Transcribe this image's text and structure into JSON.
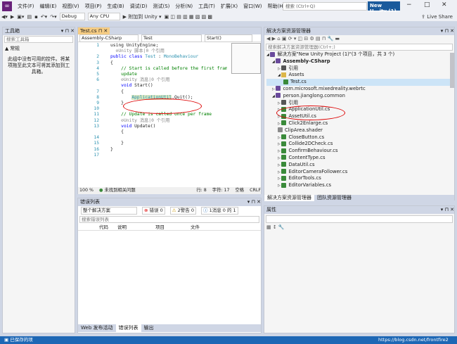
{
  "titlebar": {
    "menu": [
      "文件(F)",
      "编辑(E)",
      "视图(V)",
      "项目(P)",
      "生成(B)",
      "调试(D)",
      "测试(S)",
      "分析(N)",
      "工具(T)",
      "扩展(X)",
      "窗口(W)",
      "帮助(H)"
    ],
    "search_placeholder": "搜索 (Ctrl+Q)",
    "window_title": "New U...ity (1)"
  },
  "toolbar": {
    "config": "Debug",
    "platform": "Any CPU",
    "attach": "▶ 附加到 Unity ▾",
    "live_share": "Live Share"
  },
  "toolbox": {
    "title": "工具箱",
    "search_placeholder": "搜索工具箱",
    "group": "▲ 常规",
    "empty_message": "此组中没有可用的控件。将某项拖至此文本可将其添加到工具箱。"
  },
  "editor": {
    "tab": "Test.cs",
    "nav_project": "Assembly-CSharp",
    "nav_class": "Test",
    "nav_member": "Start()",
    "line_numbers": [
      "1",
      "2",
      "3",
      "4",
      "5",
      "6",
      "7",
      "8",
      "9",
      "10",
      "11",
      "12",
      "13",
      "14",
      "15",
      "16",
      "17"
    ],
    "zoom": "100 %",
    "issues": "未找到相关问题",
    "row": "行: 8",
    "col": "字符: 17",
    "space": "空格",
    "eol": "CRLF"
  },
  "error_list": {
    "title": "错误列表",
    "scope": "整个解决方案",
    "errors": "错误 0",
    "warnings": "2警告 0",
    "messages": "1消息 0 的 1",
    "search_placeholder": "搜索错误列表",
    "columns": [
      "代码",
      "说明",
      "项目",
      "文件"
    ],
    "bottom_tabs": [
      "Web 发布活动",
      "错误列表",
      "输出"
    ]
  },
  "solution": {
    "title": "解决方案资源管理器",
    "search_placeholder": "搜索解决方案资源管理器(Ctrl+;)",
    "items": [
      "解决方案\"New Unity Project (1)\"(3 个项目，共 3 个)",
      "Assembly-CSharp",
      "引用",
      "Assets",
      "Test.cs",
      "com.microsoft.mixedreality.webrtc",
      "person.jianglong.common",
      "引用",
      "ApplicationUtil.cs",
      "AssetUtil.cs",
      "Click2Enlarge.cs",
      "ClipArea.shader",
      "CloseButton.cs",
      "Collide2DCheck.cs",
      "ConfirmBehaviour.cs",
      "ContentType.cs",
      "DataUtil.cs",
      "EditorCameraFollower.cs",
      "EditorTools.cs",
      "EditorVariables.cs"
    ],
    "bottom_tabs": [
      "解决方案资源管理器",
      "团队资源管理器"
    ]
  },
  "properties": {
    "title": "属性"
  },
  "status": {
    "text": "已保存的项",
    "watermark": "https://blog.csdn.net/frontfire2"
  }
}
